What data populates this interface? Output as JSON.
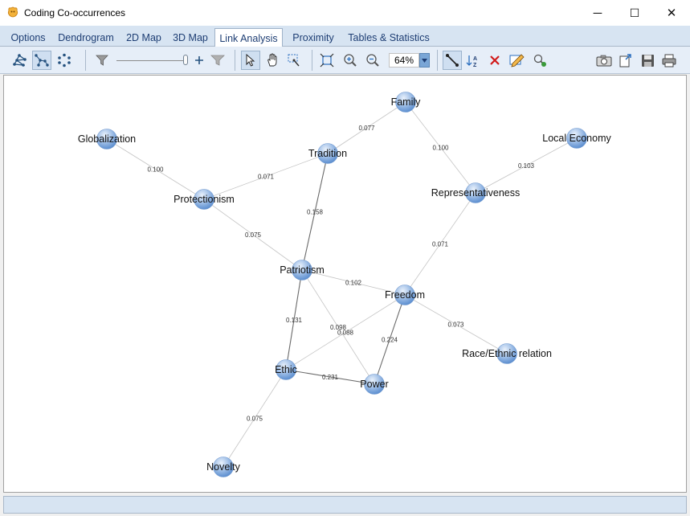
{
  "window": {
    "title": "Coding Co-occurrences",
    "controls": {
      "minimize": "─",
      "maximize": "☐",
      "close": "✕"
    }
  },
  "tabs": [
    {
      "label": "Options"
    },
    {
      "label": "Dendrogram"
    },
    {
      "label": "2D Map"
    },
    {
      "label": "3D Map"
    },
    {
      "label": "Link Analysis",
      "active": true
    },
    {
      "label": "Proximity"
    },
    {
      "label": "Tables & Statistics"
    }
  ],
  "toolbar": {
    "zoom_value": "64%",
    "icons": [
      "layout-icon",
      "layout-tree-icon",
      "layout-circle-icon",
      "filter-icon",
      "slider",
      "add-icon",
      "filter-dim-icon",
      "select-icon",
      "hand-pan-icon",
      "zoom-select-icon",
      "fit-icon",
      "zoom-in-icon",
      "zoom-out-icon",
      "zoom-combo",
      "draw-link-icon",
      "sort-az-icon",
      "delete-icon",
      "edit-icon",
      "search-node-icon",
      "camera-icon",
      "export-icon",
      "save-icon",
      "print-icon"
    ]
  },
  "colors": {
    "accent": "#1d3d73",
    "node_fill": "#8fb3e3",
    "edge": "#8a8a8a"
  },
  "network": {
    "nodes": [
      {
        "id": "Family",
        "label": "Family"
      },
      {
        "id": "Globalization",
        "label": "Globalization"
      },
      {
        "id": "Tradition",
        "label": "Tradition"
      },
      {
        "id": "LocalEconomy",
        "label": "Local Economy"
      },
      {
        "id": "Protectionism",
        "label": "Protectionism"
      },
      {
        "id": "Representativeness",
        "label": "Representativeness"
      },
      {
        "id": "Patriotism",
        "label": "Patriotism"
      },
      {
        "id": "Freedom",
        "label": "Freedom"
      },
      {
        "id": "Race",
        "label": "Race/Ethnic relation"
      },
      {
        "id": "Ethic",
        "label": "Ethic"
      },
      {
        "id": "Power",
        "label": "Power"
      },
      {
        "id": "Novelty",
        "label": "Novelty"
      }
    ],
    "edges": [
      {
        "source": "Family",
        "target": "Tradition",
        "weight": "0.077"
      },
      {
        "source": "Family",
        "target": "Representativeness",
        "weight": "0.100"
      },
      {
        "source": "Globalization",
        "target": "Protectionism",
        "weight": "0.100"
      },
      {
        "source": "Tradition",
        "target": "Protectionism",
        "weight": "0.071"
      },
      {
        "source": "Tradition",
        "target": "Patriotism",
        "weight": "0.158"
      },
      {
        "source": "LocalEconomy",
        "target": "Representativeness",
        "weight": "0.103"
      },
      {
        "source": "Representativeness",
        "target": "Freedom",
        "weight": "0.071"
      },
      {
        "source": "Protectionism",
        "target": "Patriotism",
        "weight": "0.075"
      },
      {
        "source": "Patriotism",
        "target": "Freedom",
        "weight": "0.102"
      },
      {
        "source": "Patriotism",
        "target": "Ethic",
        "weight": "0.131"
      },
      {
        "source": "Patriotism",
        "target": "Power",
        "weight": "0.098"
      },
      {
        "source": "Freedom",
        "target": "Ethic",
        "weight": "0.088"
      },
      {
        "source": "Freedom",
        "target": "Power",
        "weight": "0.224"
      },
      {
        "source": "Freedom",
        "target": "Race",
        "weight": "0.073"
      },
      {
        "source": "Ethic",
        "target": "Power",
        "weight": "0.231"
      },
      {
        "source": "Ethic",
        "target": "Novelty",
        "weight": "0.075"
      }
    ]
  }
}
